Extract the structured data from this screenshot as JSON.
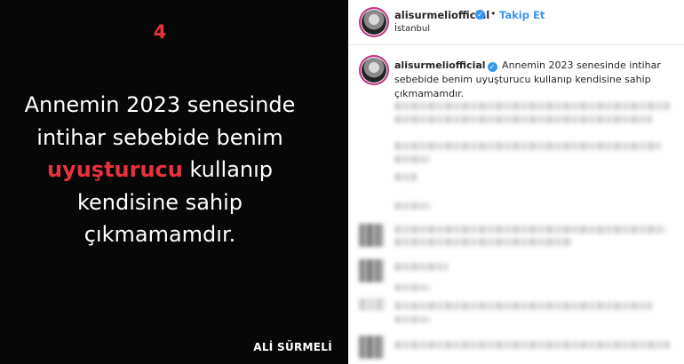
{
  "post_image": {
    "slide_number": "4",
    "quote": {
      "line1": "Annemin 2023 senesinde",
      "line2": "intihar sebebide benim",
      "line3_highlight": "uyuşturucu",
      "line3_rest": " kullanıp",
      "line4": "kendisine sahip",
      "line5": "çıkmamamdır."
    },
    "brand": "ALİ SÜRMELİ",
    "highlight_color": "#e8323c"
  },
  "header": {
    "username": "alisurmeliofficial",
    "separator": "•",
    "follow_label": "Takip Et",
    "location": "İstanbul",
    "verified_icon": "verified-badge-icon"
  },
  "caption": {
    "username": "alisurmeliofficial",
    "text": "Annemin 2023 senesinde intihar sebebide benim uyuşturucu kullanıp kendisine sahip çıkmamamdır."
  }
}
